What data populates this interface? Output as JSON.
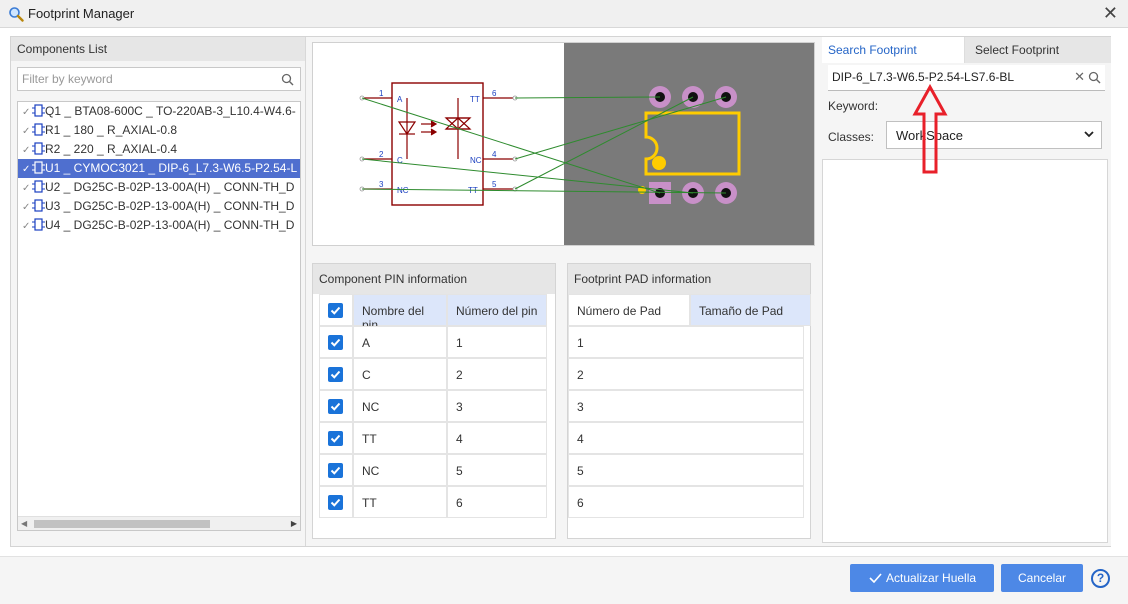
{
  "window": {
    "title": "Footprint Manager"
  },
  "components_list": {
    "header": "Components List",
    "filter_placeholder": "Filter by keyword",
    "items": [
      {
        "label": "Q1 _ BTA08-600C _ TO-220AB-3_L10.4-W4.6-",
        "selected": false
      },
      {
        "label": "R1 _ 180 _ R_AXIAL-0.8",
        "selected": false
      },
      {
        "label": "R2 _ 220 _ R_AXIAL-0.4",
        "selected": false
      },
      {
        "label": "U1 _ CYMOC3021 _ DIP-6_L7.3-W6.5-P2.54-L",
        "selected": true
      },
      {
        "label": "U2 _ DG25C-B-02P-13-00A(H) _ CONN-TH_D",
        "selected": false
      },
      {
        "label": "U3 _ DG25C-B-02P-13-00A(H) _ CONN-TH_D",
        "selected": false
      },
      {
        "label": "U4 _ DG25C-B-02P-13-00A(H) _ CONN-TH_D",
        "selected": false
      }
    ]
  },
  "preview": {
    "symbol_pins": [
      {
        "number": "1",
        "name": "A"
      },
      {
        "number": "2",
        "name": "C"
      },
      {
        "number": "3",
        "name": "NC"
      },
      {
        "number": "4",
        "name": "TT"
      },
      {
        "number": "5",
        "name": "NC"
      },
      {
        "number": "6",
        "name": "TT"
      }
    ],
    "colors": {
      "symbol": "#8b0000",
      "wire": "#2e8b2e",
      "pin_text": "#1a3fc0",
      "pcb_bg": "#7a7a7a",
      "pad_ring": "#c890c8",
      "silk": "#ffcc00"
    }
  },
  "pin_info": {
    "header": "Component PIN information",
    "col_name": "Nombre del pin",
    "col_number": "Número del pin",
    "rows": [
      {
        "name": "A",
        "number": "1"
      },
      {
        "name": "C",
        "number": "2"
      },
      {
        "name": "NC",
        "number": "3"
      },
      {
        "name": "TT",
        "number": "4"
      },
      {
        "name": "NC",
        "number": "5"
      },
      {
        "name": "TT",
        "number": "6"
      }
    ]
  },
  "pad_info": {
    "header": "Footprint PAD information",
    "col_number": "Número de Pad",
    "col_size": "Tamaño de Pad",
    "rows": [
      "1",
      "2",
      "3",
      "4",
      "5",
      "6"
    ]
  },
  "search": {
    "tab_search": "Search Footprint",
    "tab_select": "Select Footprint",
    "query": "DIP-6_L7.3-W6.5-P2.54-LS7.6-BL",
    "keyword_label": "Keyword:",
    "classes_label": "Classes:",
    "classes_value": "WorkSpace"
  },
  "footer": {
    "update_label": "Actualizar Huella",
    "cancel_label": "Cancelar",
    "help_label": "?"
  }
}
